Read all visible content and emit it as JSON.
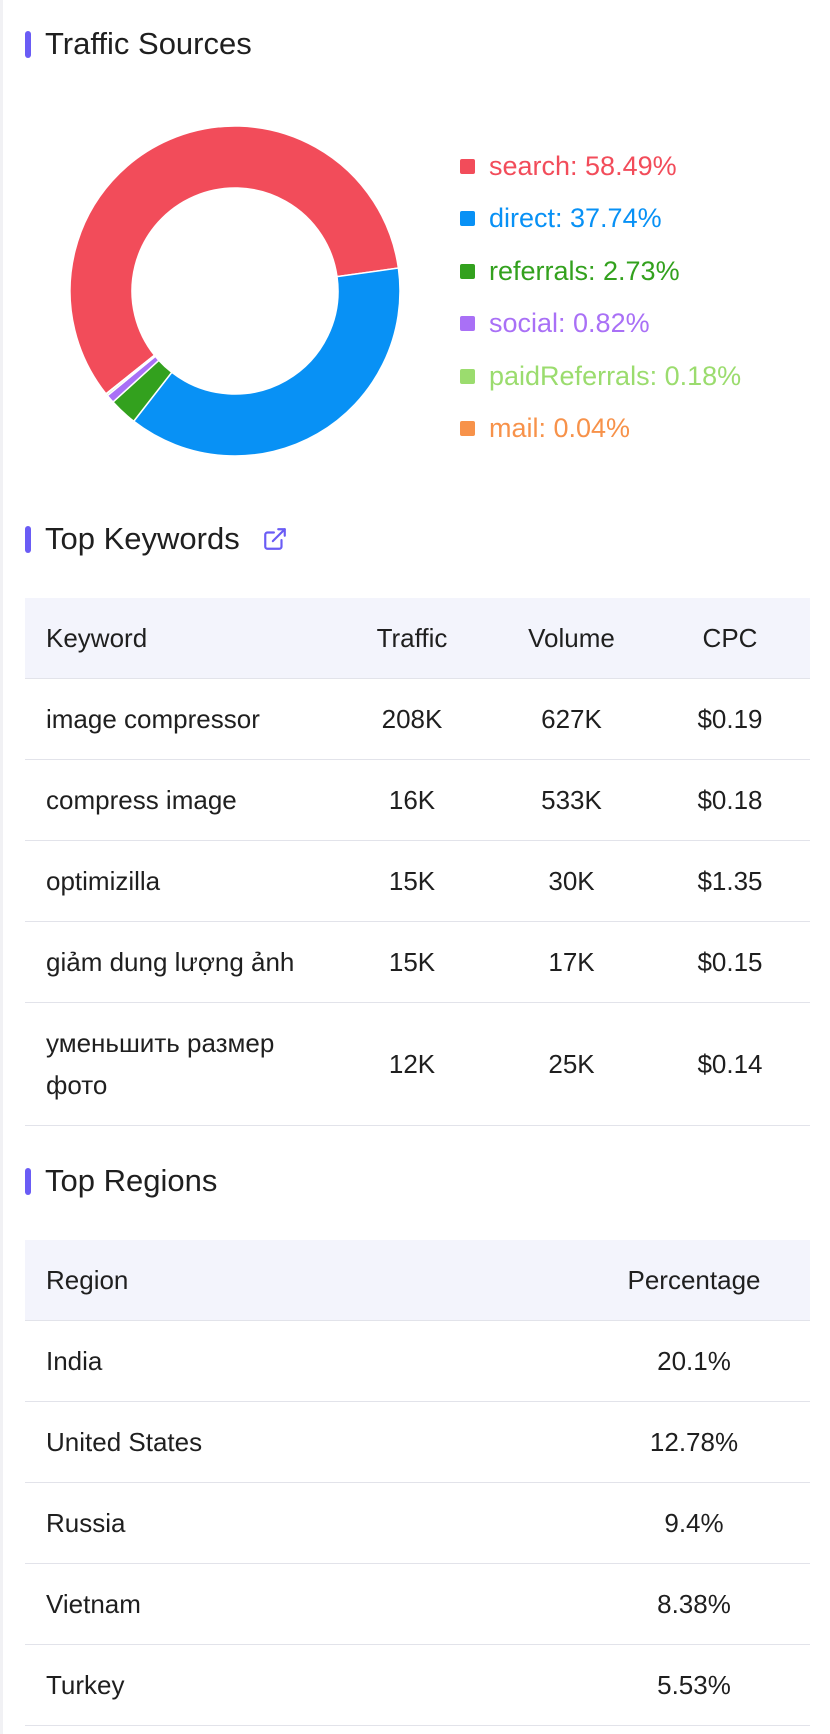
{
  "traffic_sources": {
    "title": "Traffic Sources",
    "items": [
      {
        "label": "search: 58.49%",
        "value": 58.49,
        "color": "#f24c5a"
      },
      {
        "label": "direct: 37.74%",
        "value": 37.74,
        "color": "#0891f5"
      },
      {
        "label": "referrals: 2.73%",
        "value": 2.73,
        "color": "#33a11e"
      },
      {
        "label": "social: 0.82%",
        "value": 0.82,
        "color": "#a970f6"
      },
      {
        "label": "paidReferrals: 0.18%",
        "value": 0.18,
        "color": "#9bdc6e"
      },
      {
        "label": "mail: 0.04%",
        "value": 0.04,
        "color": "#f7924a"
      }
    ]
  },
  "chart_data": {
    "type": "pie",
    "categories": [
      "search",
      "direct",
      "referrals",
      "social",
      "paidReferrals",
      "mail"
    ],
    "values": [
      58.49,
      37.74,
      2.73,
      0.82,
      0.18,
      0.04
    ],
    "title": "Traffic Sources",
    "legend": "right"
  },
  "top_keywords": {
    "title": "Top Keywords",
    "icon": "external-link-icon",
    "headers": {
      "keyword": "Keyword",
      "traffic": "Traffic",
      "volume": "Volume",
      "cpc": "CPC"
    },
    "rows": [
      {
        "keyword": "image compressor",
        "traffic": "208K",
        "volume": "627K",
        "cpc": "$0.19"
      },
      {
        "keyword": "compress image",
        "traffic": "16K",
        "volume": "533K",
        "cpc": "$0.18"
      },
      {
        "keyword": "optimizilla",
        "traffic": "15K",
        "volume": "30K",
        "cpc": "$1.35"
      },
      {
        "keyword": "giảm dung lượng ảnh",
        "traffic": "15K",
        "volume": "17K",
        "cpc": "$0.15"
      },
      {
        "keyword": "уменьшить размер фото",
        "traffic": "12K",
        "volume": "25K",
        "cpc": "$0.14"
      }
    ]
  },
  "top_regions": {
    "title": "Top Regions",
    "headers": {
      "region": "Region",
      "percentage": "Percentage"
    },
    "rows": [
      {
        "region": "India",
        "percentage": "20.1%"
      },
      {
        "region": "United States",
        "percentage": "12.78%"
      },
      {
        "region": "Russia",
        "percentage": "9.4%"
      },
      {
        "region": "Vietnam",
        "percentage": "8.38%"
      },
      {
        "region": "Turkey",
        "percentage": "5.53%"
      }
    ]
  }
}
